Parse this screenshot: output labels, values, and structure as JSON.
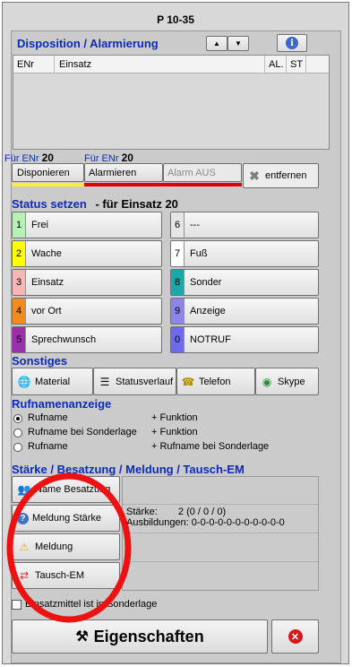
{
  "window": {
    "title": "P 10-35"
  },
  "disposition": {
    "heading": "Disposition / Alarmierung",
    "columns": [
      "ENr",
      "Einsatz",
      "AL.",
      "ST"
    ],
    "fuer_prefix": "Für ENr",
    "fuer_left": "20",
    "fuer_right": "20",
    "buttons": {
      "disponieren": "Disponieren",
      "alarmieren": "Alarmieren",
      "alarm_aus": "Alarm AUS",
      "entfernen": "entfernen"
    }
  },
  "status": {
    "heading": "Status setzen",
    "subheading": "- für Einsatz 20",
    "items": [
      {
        "num": "1",
        "label": "Frei",
        "color": "#b6f2b6"
      },
      {
        "num": "2",
        "label": "Wache",
        "color": "#ffff00"
      },
      {
        "num": "3",
        "label": "Einsatz",
        "color": "#f7b7b7"
      },
      {
        "num": "4",
        "label": "vor Ort",
        "color": "#f28c1e"
      },
      {
        "num": "5",
        "label": "Sprechwunsch",
        "color": "#9b2fae"
      },
      {
        "num": "6",
        "label": "---",
        "color": "#e6e6e6"
      },
      {
        "num": "7",
        "label": "Fuß",
        "color": "#ffffff"
      },
      {
        "num": "8",
        "label": "Sonder",
        "color": "#1aa8a8"
      },
      {
        "num": "9",
        "label": "Anzeige",
        "color": "#8b86e8"
      },
      {
        "num": "0",
        "label": "NOTRUF",
        "color": "#6e6af0"
      }
    ]
  },
  "sonstiges": {
    "heading": "Sonstiges",
    "buttons": [
      {
        "label": "Material",
        "icon": "globe-icon"
      },
      {
        "label": "Statusverlauf",
        "icon": "list-icon"
      },
      {
        "label": "Telefon",
        "icon": "telephone-icon"
      },
      {
        "label": "Skype",
        "icon": "skype-icon"
      }
    ]
  },
  "rufname": {
    "heading": "Rufnamenanzeige",
    "options": [
      {
        "left": "Rufname",
        "right": "+ Funktion",
        "selected": true
      },
      {
        "left": "Rufname bei Sonderlage",
        "right": "+ Funktion",
        "selected": false
      },
      {
        "left": "Rufname",
        "right": "+ Rufname bei Sonderlage",
        "selected": false
      }
    ]
  },
  "staerke": {
    "heading": "Stärke / Besatzung / Meldung / Tausch-EM",
    "buttons": [
      "Name Besatzung",
      "Meldung Stärke",
      "Meldung",
      "Tausch-EM"
    ],
    "staerke_label": "Stärke:",
    "staerke_value": "2  (0 / 0 / 0)",
    "ausbildungen_label": "Ausbildungen:",
    "ausbildungen_value": "0-0-0-0-0-0-0-0-0-0-0"
  },
  "checkbox": {
    "label": "Einsatzmittel ist in Sonderlage",
    "checked": false
  },
  "footer": {
    "eigenschaften": "Eigenschaften"
  },
  "colors": {
    "heading": "#0b2bb8",
    "highlight_circle": "#ee1111",
    "yellow_bar": "#ffee33",
    "red_bar": "#e00000"
  }
}
